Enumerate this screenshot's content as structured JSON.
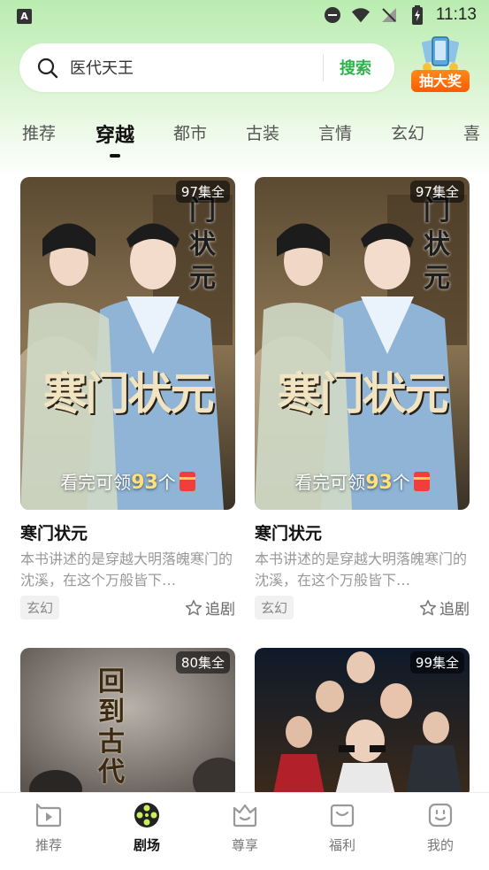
{
  "status_bar": {
    "time": "11:13",
    "app_icon_letter": "A"
  },
  "search": {
    "query": "医代天王",
    "button_label": "搜索"
  },
  "lottery": {
    "label": "抽大奖"
  },
  "tabs": [
    {
      "label": "推荐"
    },
    {
      "label": "穿越"
    },
    {
      "label": "都市"
    },
    {
      "label": "古装"
    },
    {
      "label": "言情"
    },
    {
      "label": "玄幻"
    },
    {
      "label": "喜"
    }
  ],
  "active_tab": "穿越",
  "cards": [
    {
      "badge": "97集全",
      "poster_title": "寒门状元",
      "poster_vertical": "门状元",
      "reward_prefix": "看完可领",
      "reward_num": "93",
      "reward_suffix": "个",
      "title": "寒门状元",
      "desc": "本书讲述的是穿越大明落魄寒门的沈溪，在这个万般皆下…",
      "tag": "玄幻",
      "follow_label": "追剧"
    },
    {
      "badge": "97集全",
      "poster_title": "寒门状元",
      "poster_vertical": "门状元",
      "reward_prefix": "看完可领",
      "reward_num": "93",
      "reward_suffix": "个",
      "title": "寒门状元",
      "desc": "本书讲述的是穿越大明落魄寒门的沈溪，在这个万般皆下…",
      "tag": "玄幻",
      "follow_label": "追剧"
    },
    {
      "badge": "80集全",
      "poster_text": "回到古代"
    },
    {
      "badge": "99集全"
    }
  ],
  "bottom_nav": [
    {
      "label": "推荐"
    },
    {
      "label": "剧场"
    },
    {
      "label": "尊享"
    },
    {
      "label": "福利"
    },
    {
      "label": "我的"
    }
  ],
  "colors": {
    "accent_green": "#2fb14e",
    "lottery_orange": "#ff6a0a"
  }
}
